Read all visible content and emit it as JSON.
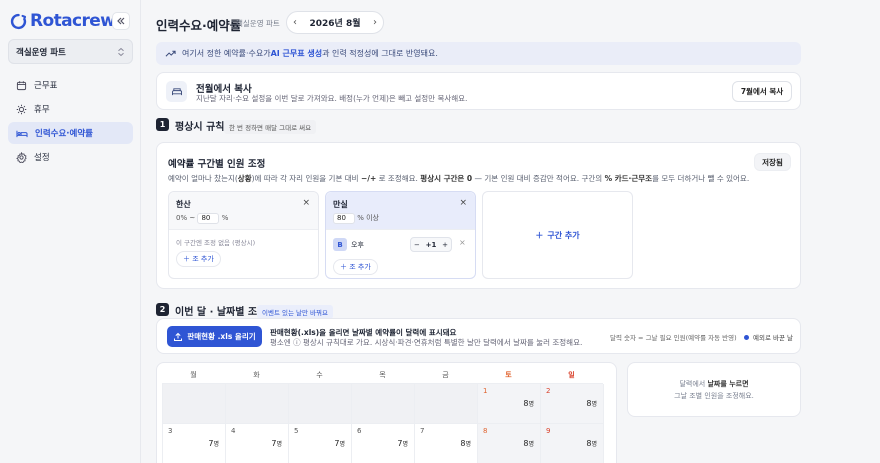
{
  "app": {
    "name": "Rotacrew",
    "org": "객실운영 파트"
  },
  "sidebar": {
    "items": [
      {
        "label": "근무표",
        "icon": "calendar-icon"
      },
      {
        "label": "휴무",
        "icon": "sun-icon"
      },
      {
        "label": "인력수요·예약률",
        "icon": "bed-icon",
        "active": true
      },
      {
        "label": "설정",
        "icon": "gear-icon"
      }
    ]
  },
  "header": {
    "title": "인력수요·예약률",
    "subtitle": "객실운영 파트",
    "month": "2026년 8월"
  },
  "banner": {
    "pre": "여기서 정한 예약률·수요가 ",
    "bold": "AI 근무표 생성",
    "post": "과 인력 적정성에 그대로 반영돼요."
  },
  "copy": {
    "title": "전월에서 복사",
    "desc": "지난달 자리·수요 설정을 이번 달로 가져와요. 배정(누가 언제)은 빼고 설정만 복사해요.",
    "button": "7월에서 복사"
  },
  "section1": {
    "num": "1",
    "title": "평상시 규칙",
    "chip": "한 번 정하면 매달 그대로 써요"
  },
  "rules": {
    "title": "예약률 구간별 인원 조정",
    "save": "저장됨",
    "desc_pre": "예약이 얼마나 찼는지(",
    "desc_b1": "상황",
    "desc_mid": ")에 따라 각 자리 인원을 기본 대비 ",
    "desc_b2": "−/+",
    "desc_mid2": " 로 조정해요. ",
    "desc_b3": "평상시 구간은 0",
    "desc_mid3": " — 기본 인원 대비 증감만 적어요. 구간의 ",
    "desc_b4": "% 카드·근무조",
    "desc_post": "를 모두 더하거나 뺄 수 있어요.",
    "bands": [
      {
        "name": "한산",
        "from": "0%",
        "sep": "~",
        "to": "80",
        "unit": "%",
        "empty": "이 구간엔 조정 없음 (평상시)",
        "add": "조 추가"
      },
      {
        "name": "만실",
        "from": "80",
        "unit": "% 이상",
        "shift_badge": "B",
        "shift_name": "오후",
        "shift_value": "+1",
        "minus": "−",
        "plus": "+",
        "add": "조 추가"
      }
    ],
    "add_band": "구간 추가"
  },
  "section2": {
    "num": "2",
    "title": "이번 달 · 날짜별 조정",
    "chip": "이벤트 있는 날만 바꿔요"
  },
  "upload": {
    "button": "판매현황 .xls 올리기",
    "title": "판매현황(.xls)을 올리면 날짜별 예약률이 달력에 표시돼요",
    "desc": "평소엔 ⓘ 평상시 규칙대로 가요. 시상식·파견·연휴처럼 특별한 날만 달력에서 날짜를 눌러 조정해요.",
    "legend1": "달력 숫자 = 그날 필요 인원(예약률 자동 반영)",
    "legend2": "예외로 바꾼 날"
  },
  "calendar": {
    "weekdays": [
      "월",
      "화",
      "수",
      "목",
      "금",
      "토",
      "일"
    ],
    "unit": "명",
    "rows": [
      [
        null,
        null,
        null,
        null,
        null,
        {
          "day": "1",
          "value": "8"
        },
        {
          "day": "2",
          "value": "8"
        }
      ],
      [
        {
          "day": "3",
          "value": "7"
        },
        {
          "day": "4",
          "value": "7"
        },
        {
          "day": "5",
          "value": "7"
        },
        {
          "day": "6",
          "value": "7"
        },
        {
          "day": "7",
          "value": "8"
        },
        {
          "day": "8",
          "value": "8"
        },
        {
          "day": "9",
          "value": "8"
        }
      ]
    ]
  },
  "hint": {
    "pre": "달력에서 ",
    "bold": "날짜를 누르면",
    "line2": "그날 조별 인원을 조정해요."
  },
  "colors": {
    "accent": "#2f55d4",
    "sunday": "#d9412b",
    "saturday": "#e0632e"
  }
}
